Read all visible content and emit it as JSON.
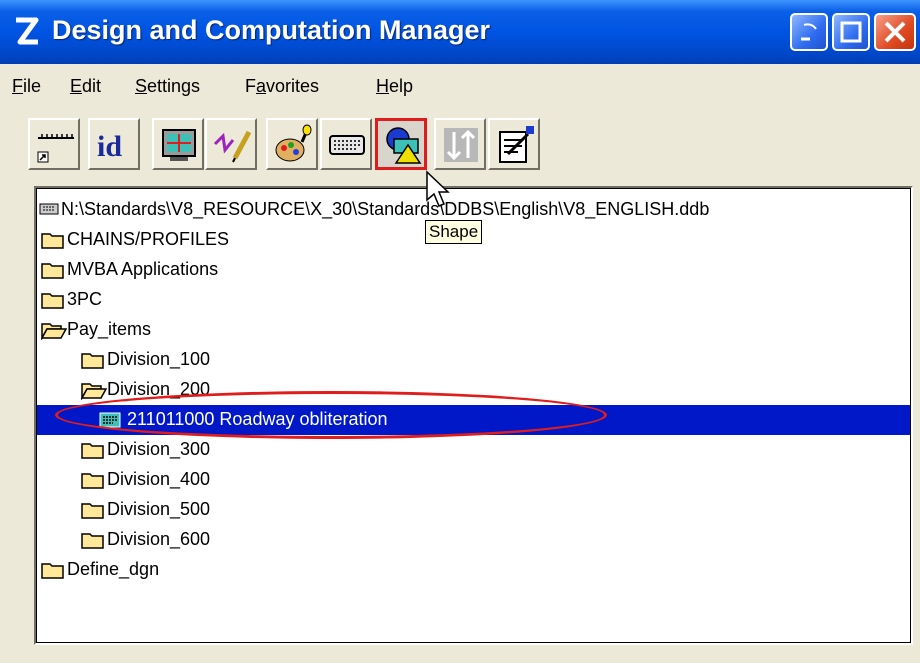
{
  "window": {
    "title": "Design and Computation Manager"
  },
  "menu": [
    {
      "pre": "",
      "u": "F",
      "post": "ile"
    },
    {
      "pre": "",
      "u": "E",
      "post": "dit"
    },
    {
      "pre": "",
      "u": "S",
      "post": "ettings"
    },
    {
      "pre": "F",
      "u": "a",
      "post": "vorites"
    },
    {
      "pre": "",
      "u": "H",
      "post": "elp"
    }
  ],
  "toolbar": {
    "tools": [
      {
        "icon": "ruler-shortcut-icon"
      },
      {
        "icon": "id-icon",
        "label": "id"
      },
      {
        "icon": "monitor-icon"
      },
      {
        "icon": "pencil-icon"
      },
      {
        "icon": "palette-icon"
      },
      {
        "icon": "keyboard-icon"
      },
      {
        "icon": "shape-icon",
        "active": true
      },
      {
        "icon": "arrows-updown-icon"
      },
      {
        "icon": "clipboard-icon"
      }
    ],
    "tooltip": "Shape"
  },
  "tree": {
    "root": "N:\\Standards\\V8_RESOURCE\\X_30\\Standards\\DDBS\\English\\V8_ENGLISH.ddb",
    "items": [
      {
        "label": "CHAINS/PROFILES",
        "level": 1,
        "icon": "folder-icon"
      },
      {
        "label": "MVBA Applications",
        "level": 1,
        "icon": "folder-icon"
      },
      {
        "label": "3PC",
        "level": 1,
        "icon": "folder-icon"
      },
      {
        "label": "Pay_items",
        "level": 1,
        "icon": "folder-open-icon"
      },
      {
        "label": "Division_100",
        "level": 2,
        "icon": "folder-icon"
      },
      {
        "label": "Division_200",
        "level": 2,
        "icon": "folder-open-icon"
      },
      {
        "label": "211011000 Roadway obliteration",
        "level": 3,
        "icon": "item-icon",
        "selected": true
      },
      {
        "label": "Division_300",
        "level": 2,
        "icon": "folder-icon"
      },
      {
        "label": "Division_400",
        "level": 2,
        "icon": "folder-icon"
      },
      {
        "label": "Division_500",
        "level": 2,
        "icon": "folder-icon"
      },
      {
        "label": "Division_600",
        "level": 2,
        "icon": "folder-icon"
      },
      {
        "label": "Define_dgn",
        "level": 1,
        "icon": "folder-icon"
      }
    ]
  },
  "colors": {
    "selection": "#0018c8",
    "annotation": "#e01c1c",
    "titlebar": "#0054e3"
  }
}
